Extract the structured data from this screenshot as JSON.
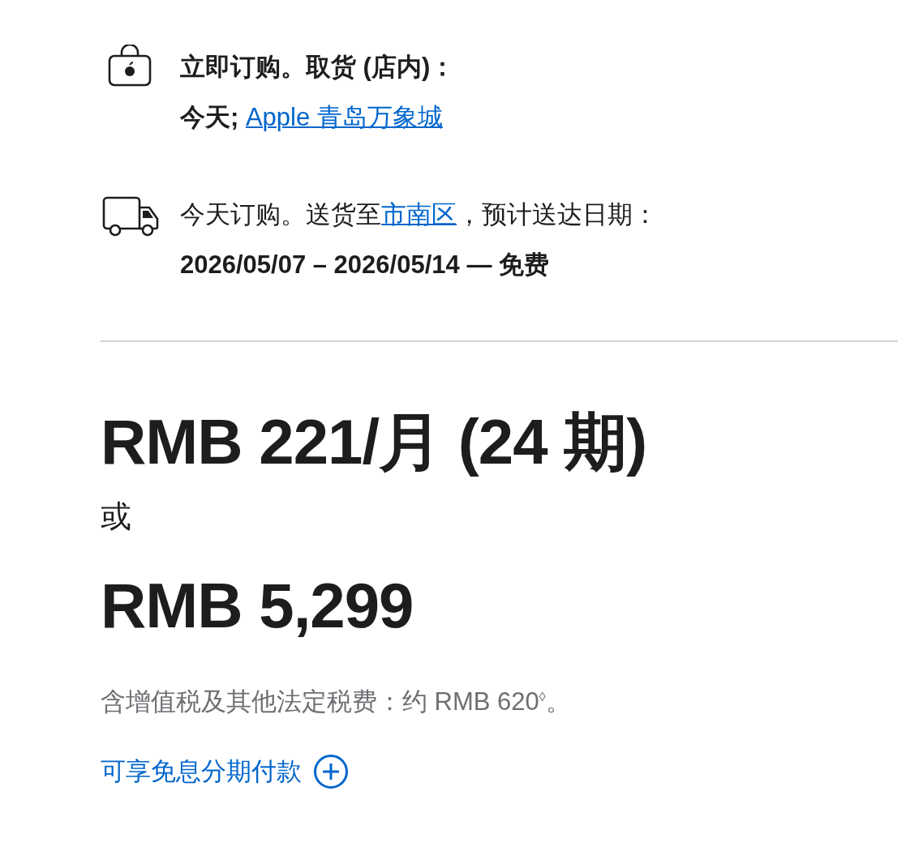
{
  "pickup": {
    "heading": "立即订购。取货 (店内)：",
    "day": "今天; ",
    "store_link": "Apple 青岛万象城"
  },
  "delivery": {
    "prefix": "今天订购。送货至",
    "area_link": "市南区",
    "suffix": "，预计送达日期：",
    "dates": "2026/05/07 – 2026/05/14 — 免费"
  },
  "price": {
    "monthly": "RMB 221/月 (24 期)",
    "or": "或",
    "full": "RMB 5,299",
    "tax_note": "含增值税及其他法定税费：约 RMB 620$^{◊}$。",
    "installment_link": "可享免息分期付款"
  }
}
